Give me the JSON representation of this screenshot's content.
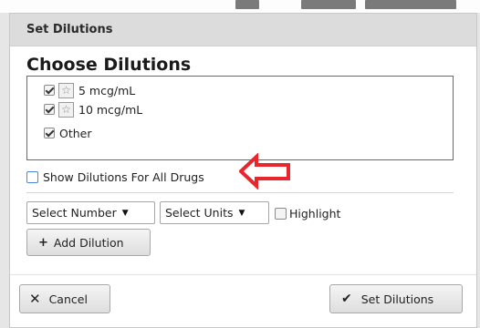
{
  "dialog": {
    "title": "Set Dilutions",
    "heading": "Choose Dilutions"
  },
  "dilutions": [
    {
      "label": "5 mcg/mL",
      "checked": true,
      "favorite_icon": "star-outline-icon"
    },
    {
      "label": "10 mcg/mL",
      "checked": true,
      "favorite_icon": "star-outline-icon"
    },
    {
      "label": "Other",
      "checked": true
    }
  ],
  "show_all": {
    "label": "Show Dilutions For All Drugs",
    "checked": false
  },
  "annotation": {
    "icon": "red-arrow-icon",
    "color": "#e8262b"
  },
  "add_form": {
    "number_select": "Select Number",
    "units_select": "Select Units",
    "highlight_label": "Highlight",
    "highlight_checked": false,
    "add_button": "Add Dilution"
  },
  "footer": {
    "cancel_label": "Cancel",
    "confirm_label": "Set Dilutions"
  },
  "colors": {
    "accent": "#4c86d8",
    "arrow": "#e8262b"
  }
}
